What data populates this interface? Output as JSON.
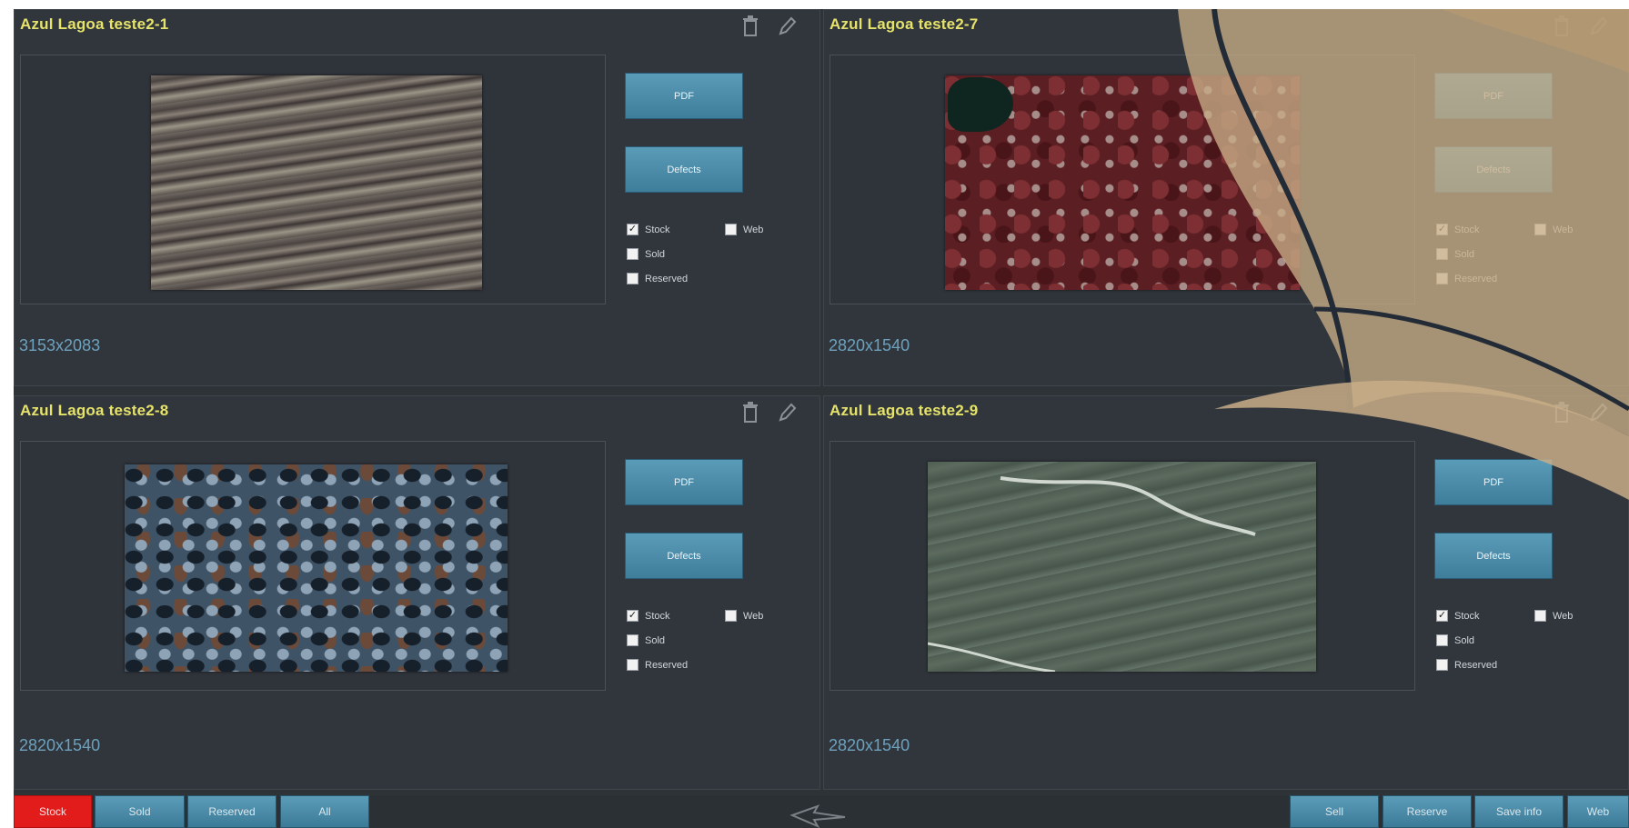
{
  "panels": [
    {
      "title": "Azul Lagoa teste2-1",
      "dims": "3153x2083",
      "pdf_label": "PDF",
      "defects_label": "Defects",
      "stock_label": "Stock",
      "sold_label": "Sold",
      "reserved_label": "Reserved",
      "web_label": "Web",
      "stock": true,
      "sold": false,
      "reserved": false,
      "web": false
    },
    {
      "title": "Azul Lagoa teste2-7",
      "dims": "2820x1540",
      "pdf_label": "PDF",
      "defects_label": "Defects",
      "stock_label": "Stock",
      "sold_label": "Sold",
      "reserved_label": "Reserved",
      "web_label": "Web",
      "stock": true,
      "sold": false,
      "reserved": false,
      "web": false
    },
    {
      "title": "Azul Lagoa teste2-8",
      "dims": "2820x1540",
      "pdf_label": "PDF",
      "defects_label": "Defects",
      "stock_label": "Stock",
      "sold_label": "Sold",
      "reserved_label": "Reserved",
      "web_label": "Web",
      "stock": true,
      "sold": false,
      "reserved": false,
      "web": false
    },
    {
      "title": "Azul Lagoa teste2-9",
      "dims": "2820x1540",
      "pdf_label": "PDF",
      "defects_label": "Defects",
      "stock_label": "Stock",
      "sold_label": "Sold",
      "reserved_label": "Reserved",
      "web_label": "Web",
      "stock": true,
      "sold": false,
      "reserved": false,
      "web": false
    }
  ],
  "filters": {
    "stock": "Stock",
    "sold": "Sold",
    "reserved": "Reserved",
    "all": "All",
    "active": "stock"
  },
  "actions": {
    "sell": "Sell",
    "reserve": "Reserve",
    "save_info": "Save info",
    "web": "Web"
  },
  "icons": {
    "delete": "trash-icon",
    "edit": "pencil-icon",
    "back": "back-arrow-icon"
  },
  "colors": {
    "title": "#e6e36a",
    "dims": "#6da1bd",
    "button": "#4a8aa8",
    "active_filter": "#e21b1b",
    "panel": "#31363c"
  }
}
